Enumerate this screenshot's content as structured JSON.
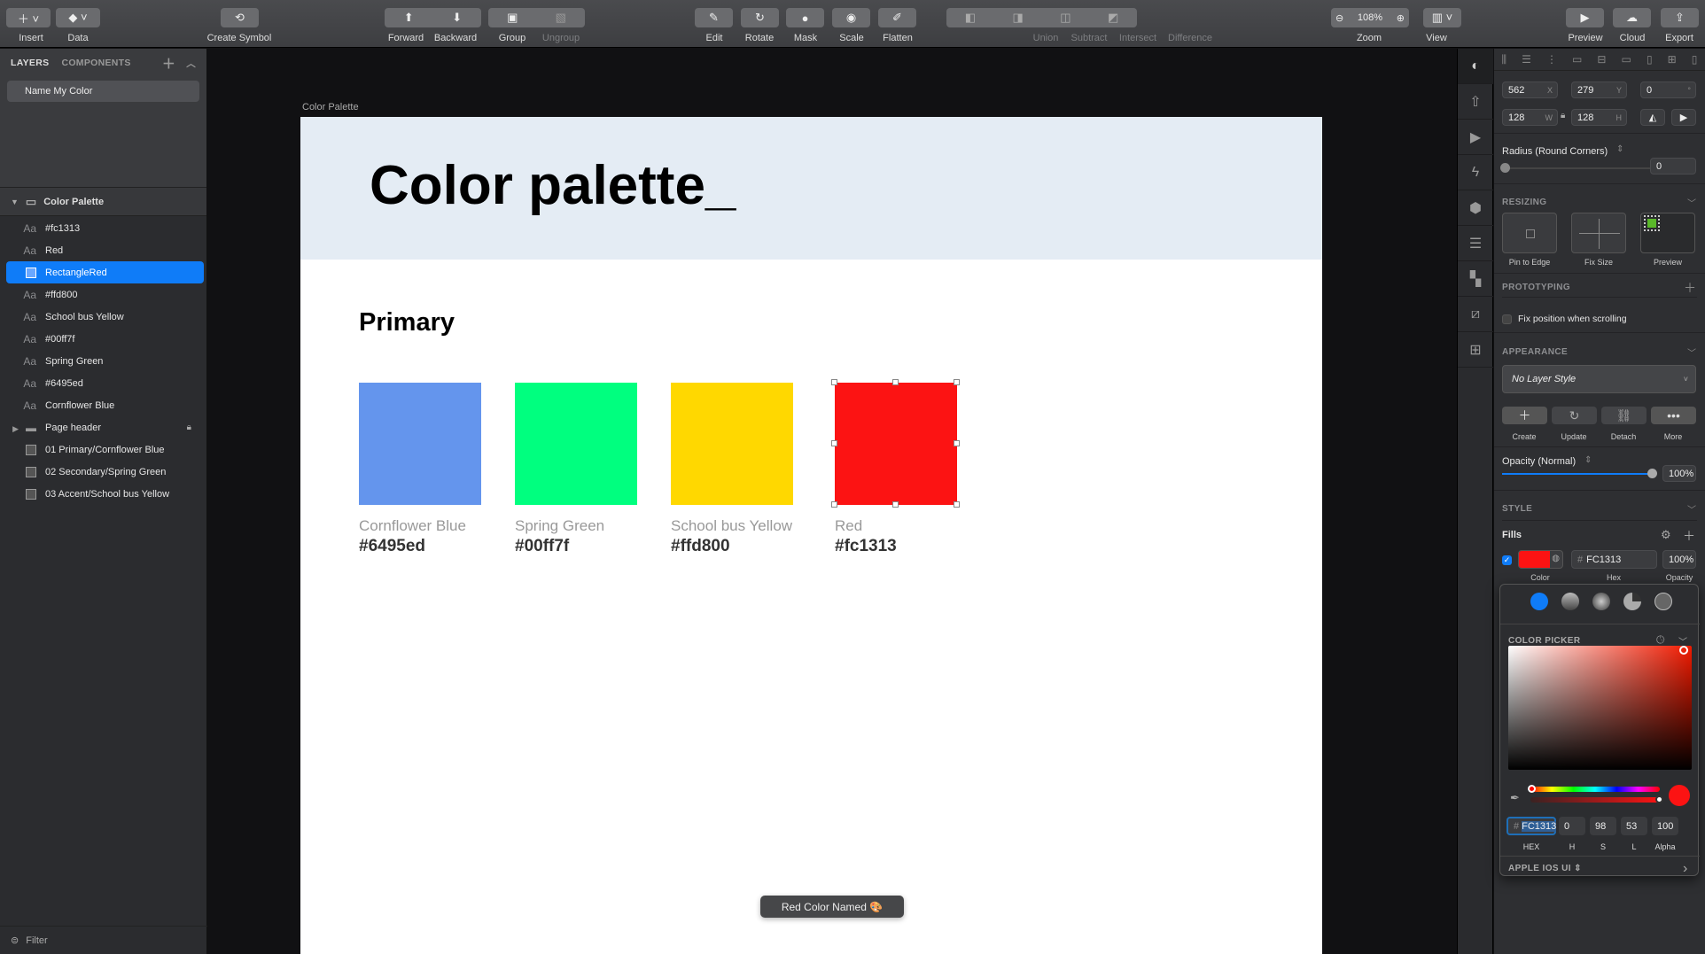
{
  "toolbar": {
    "insert": "Insert",
    "data": "Data",
    "create_symbol": "Create Symbol",
    "forward": "Forward",
    "backward": "Backward",
    "group": "Group",
    "ungroup": "Ungroup",
    "edit": "Edit",
    "rotate": "Rotate",
    "mask": "Mask",
    "scale": "Scale",
    "flatten": "Flatten",
    "union": "Union",
    "subtract": "Subtract",
    "intersect": "Intersect",
    "difference": "Difference",
    "zoom_value": "108%",
    "zoom": "Zoom",
    "view": "View",
    "preview": "Preview",
    "cloud": "Cloud",
    "export": "Export"
  },
  "left_panel": {
    "tabs": [
      "LAYERS",
      "COMPONENTS"
    ],
    "page": "Name My Color",
    "artboard": "Color Palette",
    "layers": [
      {
        "type": "text",
        "label": "#fc1313"
      },
      {
        "type": "text",
        "label": "Red"
      },
      {
        "type": "rect",
        "label": "RectangleRed",
        "selected": true
      },
      {
        "type": "text",
        "label": "#ffd800"
      },
      {
        "type": "text",
        "label": "School bus Yellow"
      },
      {
        "type": "text",
        "label": "#00ff7f"
      },
      {
        "type": "text",
        "label": "Spring Green"
      },
      {
        "type": "text",
        "label": "#6495ed"
      },
      {
        "type": "text",
        "label": "Cornflower Blue"
      },
      {
        "type": "group",
        "label": "Page header",
        "locked": true
      },
      {
        "type": "symbol",
        "label": "01 Primary/Cornflower Blue"
      },
      {
        "type": "symbol",
        "label": "02 Secondary/Spring Green"
      },
      {
        "type": "symbol",
        "label": "03 Accent/School bus Yellow"
      }
    ],
    "filter": "Filter"
  },
  "canvas": {
    "artboard_label": "Color Palette",
    "title": "Color palette_",
    "section": "Primary",
    "swatches": [
      {
        "name": "Cornflower Blue",
        "hex": "#6495ed",
        "color": "#6495ed"
      },
      {
        "name": "Spring Green",
        "hex": "#00ff7f",
        "color": "#00ff7f"
      },
      {
        "name": "School bus Yellow",
        "hex": "#ffd800",
        "color": "#ffd800"
      },
      {
        "name": "Red",
        "hex": "#fc1313",
        "color": "#fc1313"
      }
    ],
    "toast": "Red Color Named 🎨"
  },
  "inspector": {
    "x": "562",
    "x_unit": "X",
    "y": "279",
    "y_unit": "Y",
    "rotation": "0",
    "rotation_unit": "°",
    "w": "128",
    "w_unit": "W",
    "h": "128",
    "h_unit": "H",
    "radius_label": "Radius (Round Corners)",
    "radius": "0",
    "resizing": "RESIZING",
    "pin_to_edge": "Pin to Edge",
    "fix_size": "Fix Size",
    "preview": "Preview",
    "prototyping": "PROTOTYPING",
    "fix_position": "Fix position when scrolling",
    "appearance": "APPEARANCE",
    "layer_style": "No Layer Style",
    "create": "Create",
    "update": "Update",
    "detach": "Detach",
    "more": "More",
    "opacity_label": "Opacity (Normal)",
    "opacity": "100%",
    "opacity_value": 100,
    "style": "STYLE",
    "fills": "Fills",
    "fill_hex": "FC1313",
    "fill_opacity": "100%",
    "color_lbl": "Color",
    "hex_lbl": "Hex",
    "opacity_lbl": "Opacity",
    "fill_color": "#fc1313"
  },
  "color_picker": {
    "title": "COLOR PICKER",
    "hex": "FC1313",
    "h": "0",
    "s": "98",
    "l": "53",
    "alpha": "100",
    "labels": {
      "hex": "HEX",
      "h": "H",
      "s": "S",
      "l": "L",
      "alpha": "Alpha"
    },
    "palette": "APPLE IOS UI"
  }
}
